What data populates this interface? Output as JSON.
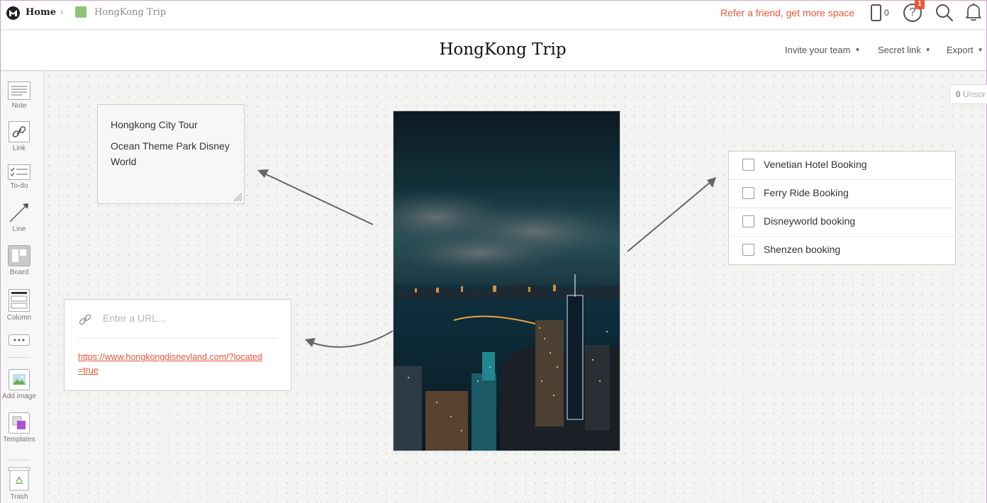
{
  "breadcrumb": {
    "home": "Home",
    "separator": "›",
    "board": "HongKong Trip",
    "board_color": "#8fc27a"
  },
  "topbar": {
    "refer": "Refer a friend, get more space",
    "phone_count": "0",
    "help_icon": "?",
    "help_badge": "1",
    "accent": "#e8573a"
  },
  "board": {
    "title": "HongKong Trip"
  },
  "titlebar_menu": {
    "invite": "Invite your team",
    "secret_link": "Secret link",
    "export": "Export"
  },
  "sidebar": {
    "tools": [
      {
        "label": "Note",
        "icon": "note-icon"
      },
      {
        "label": "Link",
        "icon": "link-icon"
      },
      {
        "label": "To-do",
        "icon": "todo-icon"
      },
      {
        "label": "Line",
        "icon": "line-icon"
      },
      {
        "label": "Board",
        "icon": "board-icon"
      },
      {
        "label": "Column",
        "icon": "column-icon"
      },
      {
        "label": "",
        "icon": "more-icon"
      },
      {
        "label": "Add image",
        "icon": "add-image-icon"
      },
      {
        "label": "Templates",
        "icon": "templates-icon"
      },
      {
        "label": "Trash",
        "icon": "trash-icon"
      }
    ]
  },
  "canvas": {
    "unsorted": {
      "count": "0",
      "label": "Unsor"
    },
    "note": {
      "lines": [
        "Hongkong City Tour",
        "Ocean Theme Park Disney World"
      ]
    },
    "link_card": {
      "placeholder": "Enter a URL...",
      "url": "https://www.hongkongdisneyland.com/?located=true"
    },
    "image": {
      "subject": "Hong Kong city skyline at night"
    },
    "todo": {
      "items": [
        {
          "label": "Venetian Hotel Booking",
          "checked": false
        },
        {
          "label": "Ferry Ride Booking",
          "checked": false
        },
        {
          "label": "Disneyworld booking",
          "checked": false
        },
        {
          "label": "Shenzen booking",
          "checked": false
        }
      ]
    }
  }
}
